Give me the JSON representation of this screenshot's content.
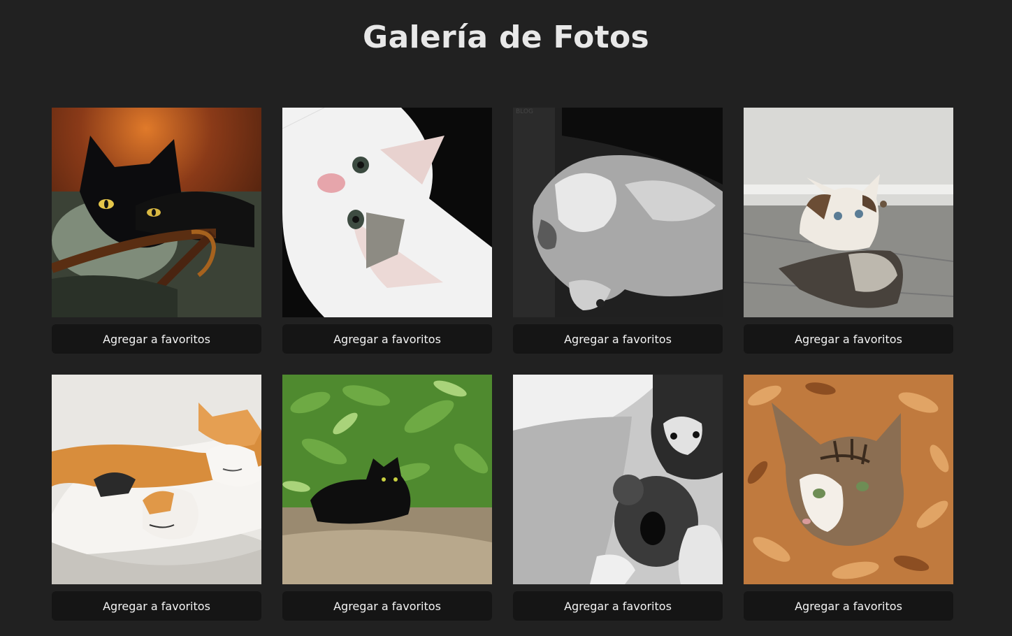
{
  "page": {
    "title": "Galería de Fotos"
  },
  "gallery": {
    "photos": [
      {
        "subject": "black cat lying in a wicker basket",
        "button_label": "Agregar a favoritos"
      },
      {
        "subject": "white kitten with head tilted upside down",
        "button_label": "Agregar a favoritos"
      },
      {
        "subject": "fluffy kitten lying on its back, black and white photo",
        "button_label": "Agregar a favoritos"
      },
      {
        "subject": "calico kitten sitting inside a shoe",
        "button_label": "Agregar a favoritos"
      },
      {
        "subject": "orange and white kittens sleeping together in a bowl",
        "button_label": "Agregar a favoritos"
      },
      {
        "subject": "black cat lying among green plants",
        "button_label": "Agregar a favoritos"
      },
      {
        "subject": "kitten hugging a teddy bear under a blanket, black and white photo",
        "button_label": "Agregar a favoritos"
      },
      {
        "subject": "tabby kitten hiding in autumn leaves",
        "button_label": "Agregar a favoritos"
      }
    ]
  },
  "colors": {
    "background": "#212121",
    "button_background": "#151515",
    "text": "#ececec"
  }
}
